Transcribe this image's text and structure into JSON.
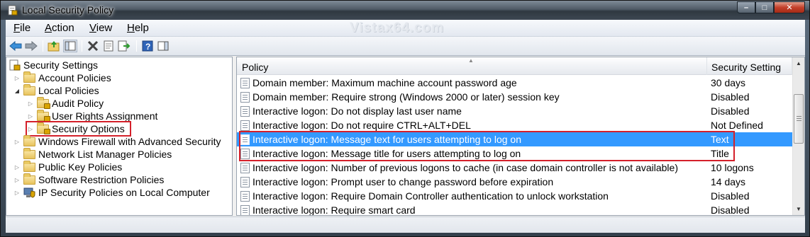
{
  "window": {
    "title": "Local Security Policy",
    "minimize_glyph": "–",
    "maximize_glyph": "□",
    "close_glyph": "✕"
  },
  "watermark": "Vistax64.com",
  "menu": {
    "file": {
      "ul": "F",
      "rest": "ile"
    },
    "action": {
      "ul": "A",
      "rest": "ction"
    },
    "view": {
      "ul": "V",
      "rest": "iew"
    },
    "help": {
      "ul": "H",
      "rest": "elp"
    }
  },
  "toolbar": {
    "icons": [
      "back-arrow-icon",
      "forward-arrow-icon",
      "up-folder-icon",
      "show-hide-tree-icon",
      "delete-icon",
      "properties-icon",
      "export-list-icon",
      "help-icon",
      "show-hide-action-pane-icon"
    ]
  },
  "tree": {
    "root": "Security Settings",
    "items": [
      {
        "label": "Account Policies"
      },
      {
        "label": "Local Policies"
      },
      {
        "label": "Audit Policy"
      },
      {
        "label": "User Rights Assignment"
      },
      {
        "label": "Security Options"
      },
      {
        "label": "Windows Firewall with Advanced Security"
      },
      {
        "label": "Network List Manager Policies"
      },
      {
        "label": "Public Key Policies"
      },
      {
        "label": "Software Restriction Policies"
      },
      {
        "label": "IP Security Policies on Local Computer"
      }
    ]
  },
  "list": {
    "columns": {
      "policy": "Policy",
      "setting": "Security Setting"
    },
    "rows": [
      {
        "policy": "Domain member: Maximum machine account password age",
        "setting": "30 days"
      },
      {
        "policy": "Domain member: Require strong (Windows 2000 or later) session key",
        "setting": "Disabled"
      },
      {
        "policy": "Interactive logon: Do not display last user name",
        "setting": "Disabled"
      },
      {
        "policy": "Interactive logon: Do not require CTRL+ALT+DEL",
        "setting": "Not Defined"
      },
      {
        "policy": "Interactive logon: Message text for users attempting to log on",
        "setting": "Text"
      },
      {
        "policy": "Interactive logon: Message title for users attempting to log on",
        "setting": "Title"
      },
      {
        "policy": "Interactive logon: Number of previous logons to cache (in case domain controller is not available)",
        "setting": "10 logons"
      },
      {
        "policy": "Interactive logon: Prompt user to change password before expiration",
        "setting": "14 days"
      },
      {
        "policy": "Interactive logon: Require Domain Controller authentication to unlock workstation",
        "setting": "Disabled"
      },
      {
        "policy": "Interactive logon: Require smart card",
        "setting": "Disabled"
      }
    ]
  },
  "colors": {
    "selection": "#3399ff",
    "highlight_box": "#d4202a"
  }
}
